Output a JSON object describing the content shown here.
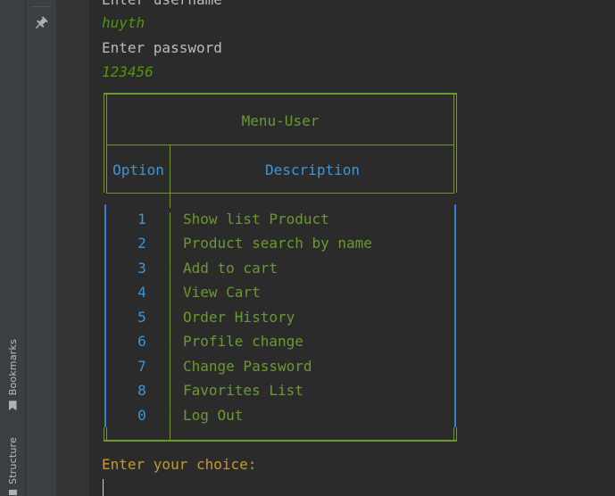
{
  "sidebar": {
    "bookmarks_label": "Bookmarks",
    "structure_label": "Structure"
  },
  "toolbar": {
    "pin_icon": "pin-icon"
  },
  "console": {
    "prompt_username": "Enter username",
    "input_username": "huyth",
    "prompt_password": "Enter password",
    "input_password": "123456",
    "choice_prompt": "Enter your choice:"
  },
  "menu": {
    "title": "Menu-User",
    "header_option": "Option",
    "header_description": "Description",
    "items": [
      {
        "option": "1",
        "description": "Show list Product"
      },
      {
        "option": "2",
        "description": "Product search by name"
      },
      {
        "option": "3",
        "description": "Add to cart"
      },
      {
        "option": "4",
        "description": "View Cart"
      },
      {
        "option": "5",
        "description": "Order History"
      },
      {
        "option": "6",
        "description": "Profile change"
      },
      {
        "option": "7",
        "description": "Change Password"
      },
      {
        "option": "8",
        "description": "Favorites List"
      },
      {
        "option": "0",
        "description": "Log Out"
      }
    ]
  },
  "colors": {
    "input_text": "#4e9a06",
    "table_green": "#6a9a2f",
    "table_blue": "#3f96d6",
    "prompt_gold": "#c39b2a"
  }
}
